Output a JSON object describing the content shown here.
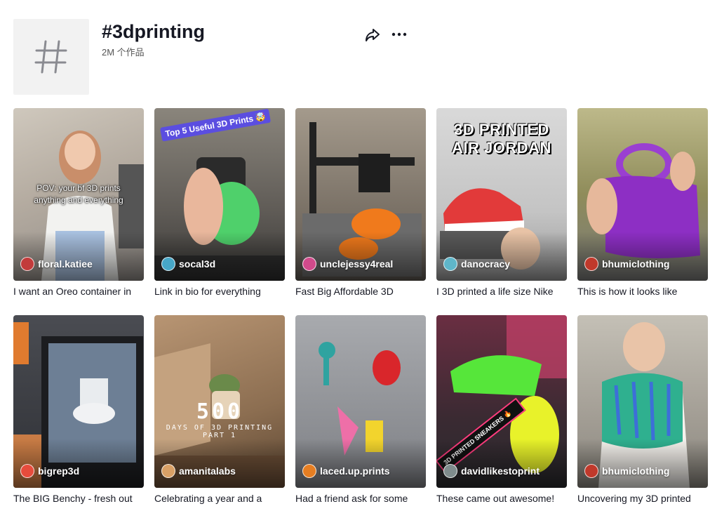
{
  "header": {
    "title": "#3dprinting",
    "count": "2M 个作品",
    "hash_symbol": "#"
  },
  "videos": [
    {
      "author": "floral.katiee",
      "caption": "I want an Oreo container in",
      "overlay": "POV: your bf 3D prints anything and everything",
      "bg": "#b9b2a8",
      "avatar": "#c23b3b"
    },
    {
      "author": "socal3d",
      "caption": "Link in bio for everything",
      "badge": "Top 5 Useful 3D Prints 🤯",
      "bg": "#6f6a63",
      "avatar": "#47a7c7"
    },
    {
      "author": "unclejessy4real",
      "caption": "Fast Big Affordable 3D",
      "bg": "#8a7f70",
      "avatar": "#d14a8b"
    },
    {
      "author": "danocracy",
      "caption": "I 3D printed a life size Nike",
      "title": "3D PRINTED AIR JORDAN",
      "bg": "#cfcfcf",
      "avatar": "#5fb6c9"
    },
    {
      "author": "bhumiclothing",
      "caption": "This is how it looks like",
      "bg": "#8b8a4a",
      "avatar": "#c0392b"
    },
    {
      "author": "bigrep3d",
      "caption": "The BIG Benchy - fresh out",
      "bg": "#3d3f44",
      "avatar": "#e74c3c"
    },
    {
      "author": "amanitalabs",
      "caption": "Celebrating a year and a",
      "pixel_num": "500",
      "pixel_sub": "DAYS OF 3D PRINTING",
      "pixel_part": "PART 1",
      "bg": "#9a7a5a",
      "avatar": "#d9a066"
    },
    {
      "author": "laced.up.prints",
      "caption": "Had a friend ask for some",
      "bg": "#8f9196",
      "avatar": "#e67e22"
    },
    {
      "author": "davidlikestoprint",
      "caption": "These came out awesome!",
      "banner": "3D PRINTED SNEAKERS 🔥",
      "bg": "#5a2a3a",
      "avatar": "#7f8c8d"
    },
    {
      "author": "bhumiclothing",
      "caption": "Uncovering my 3D printed",
      "bg": "#a9a49b",
      "avatar": "#c0392b"
    }
  ]
}
